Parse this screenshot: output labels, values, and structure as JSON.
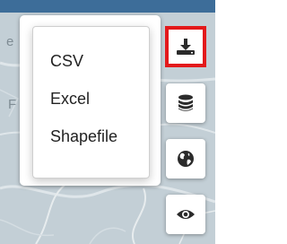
{
  "export_menu": {
    "items": [
      {
        "label": "CSV"
      },
      {
        "label": "Excel"
      },
      {
        "label": "Shapefile"
      }
    ]
  },
  "toolbar": {
    "buttons": [
      {
        "icon": "download-icon",
        "active": true
      },
      {
        "icon": "database-icon",
        "active": false
      },
      {
        "icon": "globe-icon",
        "active": false
      },
      {
        "icon": "eye-icon",
        "active": false
      }
    ]
  },
  "map": {
    "fragment_labels": [
      "e",
      "e",
      "F"
    ]
  },
  "colors": {
    "highlight": "#e3191b",
    "icon": "#2b2b2b",
    "map_background": "#c3cfd6"
  }
}
